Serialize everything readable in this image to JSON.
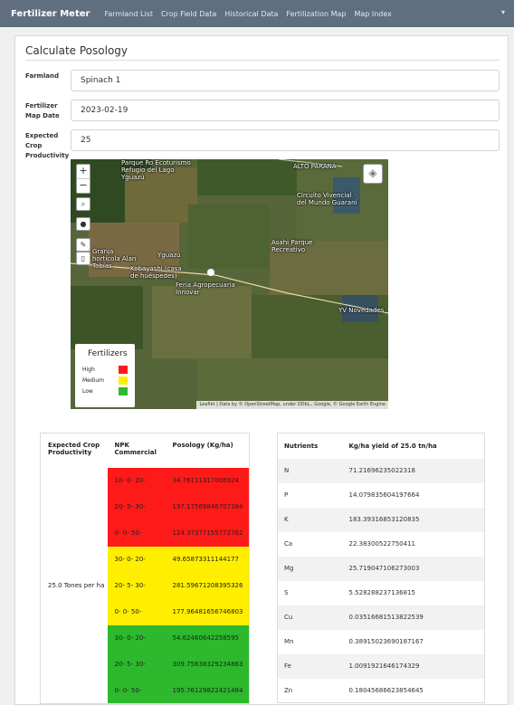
{
  "navbar": {
    "brand": "Fertilizer Meter",
    "links": [
      "Farmland List",
      "Crop Field Data",
      "Historical Data",
      "Fertilization Map",
      "Map Index"
    ],
    "caret": "▾"
  },
  "page": {
    "title": "Calculate Posology"
  },
  "form": {
    "farmland_label": "Farmland",
    "farmland_value": "Spinach 1",
    "date_label": "Fertilizer Map Date",
    "date_value": "2023-02-19",
    "productivity_label": "Expected Crop Productivity",
    "productivity_value": "25"
  },
  "map": {
    "zoom_in": "+",
    "zoom_out": "−",
    "places": {
      "parque": "Parque Ro Ecoturismo Refugio del Lago Yguazú",
      "alto_parana": "ALTO PARANÁ",
      "circuito": "Circuito Vivencial del Mundo Guaraní",
      "asahi": "Asahi Parque Recreativo",
      "granja": "Granja hortícola Alan Tobías",
      "yguazu": "Yguazú",
      "kobayashi": "Kobayashi (casa de huéspedes)",
      "feria": "Feria Agropecuaria Innovar",
      "yv": "YV Novedades"
    },
    "attribution": "Leaflet | Data by © OpenStreetMap, under ODbL., Google, © Google Earth Engine",
    "legend": {
      "title": "Fertilizers",
      "items": [
        {
          "label": "High",
          "color": "#ff1a1a"
        },
        {
          "label": "Medium",
          "color": "#ffee00"
        },
        {
          "label": "Low",
          "color": "#2db82d"
        }
      ]
    }
  },
  "posology_table": {
    "headers": [
      "Expected Crop Productivity",
      "NPK Commercial",
      "Posology (Kg/ha)"
    ],
    "productivity_cell": "25.0 Tones per ha",
    "colors": {
      "high": "#ff1a1a",
      "medium": "#ffee00",
      "low": "#2db82d"
    },
    "rows": [
      {
        "npk": "10- 0- 20-",
        "value": "34.76111317006924",
        "level": "high"
      },
      {
        "npk": "20- 5- 30-",
        "value": "197.17569846707384",
        "level": "high"
      },
      {
        "npk": "0- 0- 50-",
        "value": "124.37377155772762",
        "level": "high"
      },
      {
        "npk": "30- 0- 20-",
        "value": "49.65873311144177",
        "level": "medium"
      },
      {
        "npk": "20- 5- 30-",
        "value": "281.59671208395326",
        "level": "medium"
      },
      {
        "npk": "0- 0- 50-",
        "value": "177.96481656746803",
        "level": "medium"
      },
      {
        "npk": "30- 0- 20-",
        "value": "54.62460642258595",
        "level": "low"
      },
      {
        "npk": "20- 5- 30-",
        "value": "309.75638329234863",
        "level": "low"
      },
      {
        "npk": "0- 0- 50-",
        "value": "195.76129822421484",
        "level": "low"
      }
    ]
  },
  "nutrients_table": {
    "headers": [
      "Nutrients",
      "Kg/ha yield of 25.0 tn/ha"
    ],
    "rows": [
      {
        "name": "N",
        "value": "71.21696235022318"
      },
      {
        "name": "P",
        "value": "14.079835604197664"
      },
      {
        "name": "K",
        "value": "183.39316853120835"
      },
      {
        "name": "Ca",
        "value": "22.38300522750411"
      },
      {
        "name": "Mg",
        "value": "25.719047106273003"
      },
      {
        "name": "S",
        "value": "5.528288237136815"
      },
      {
        "name": "Cu",
        "value": "0.035166815138225​39"
      },
      {
        "name": "Mn",
        "value": "0.38915023690187167"
      },
      {
        "name": "Fe",
        "value": "1.0091921646174329"
      },
      {
        "name": "Zn",
        "value": "0.18045686623854645"
      }
    ]
  }
}
